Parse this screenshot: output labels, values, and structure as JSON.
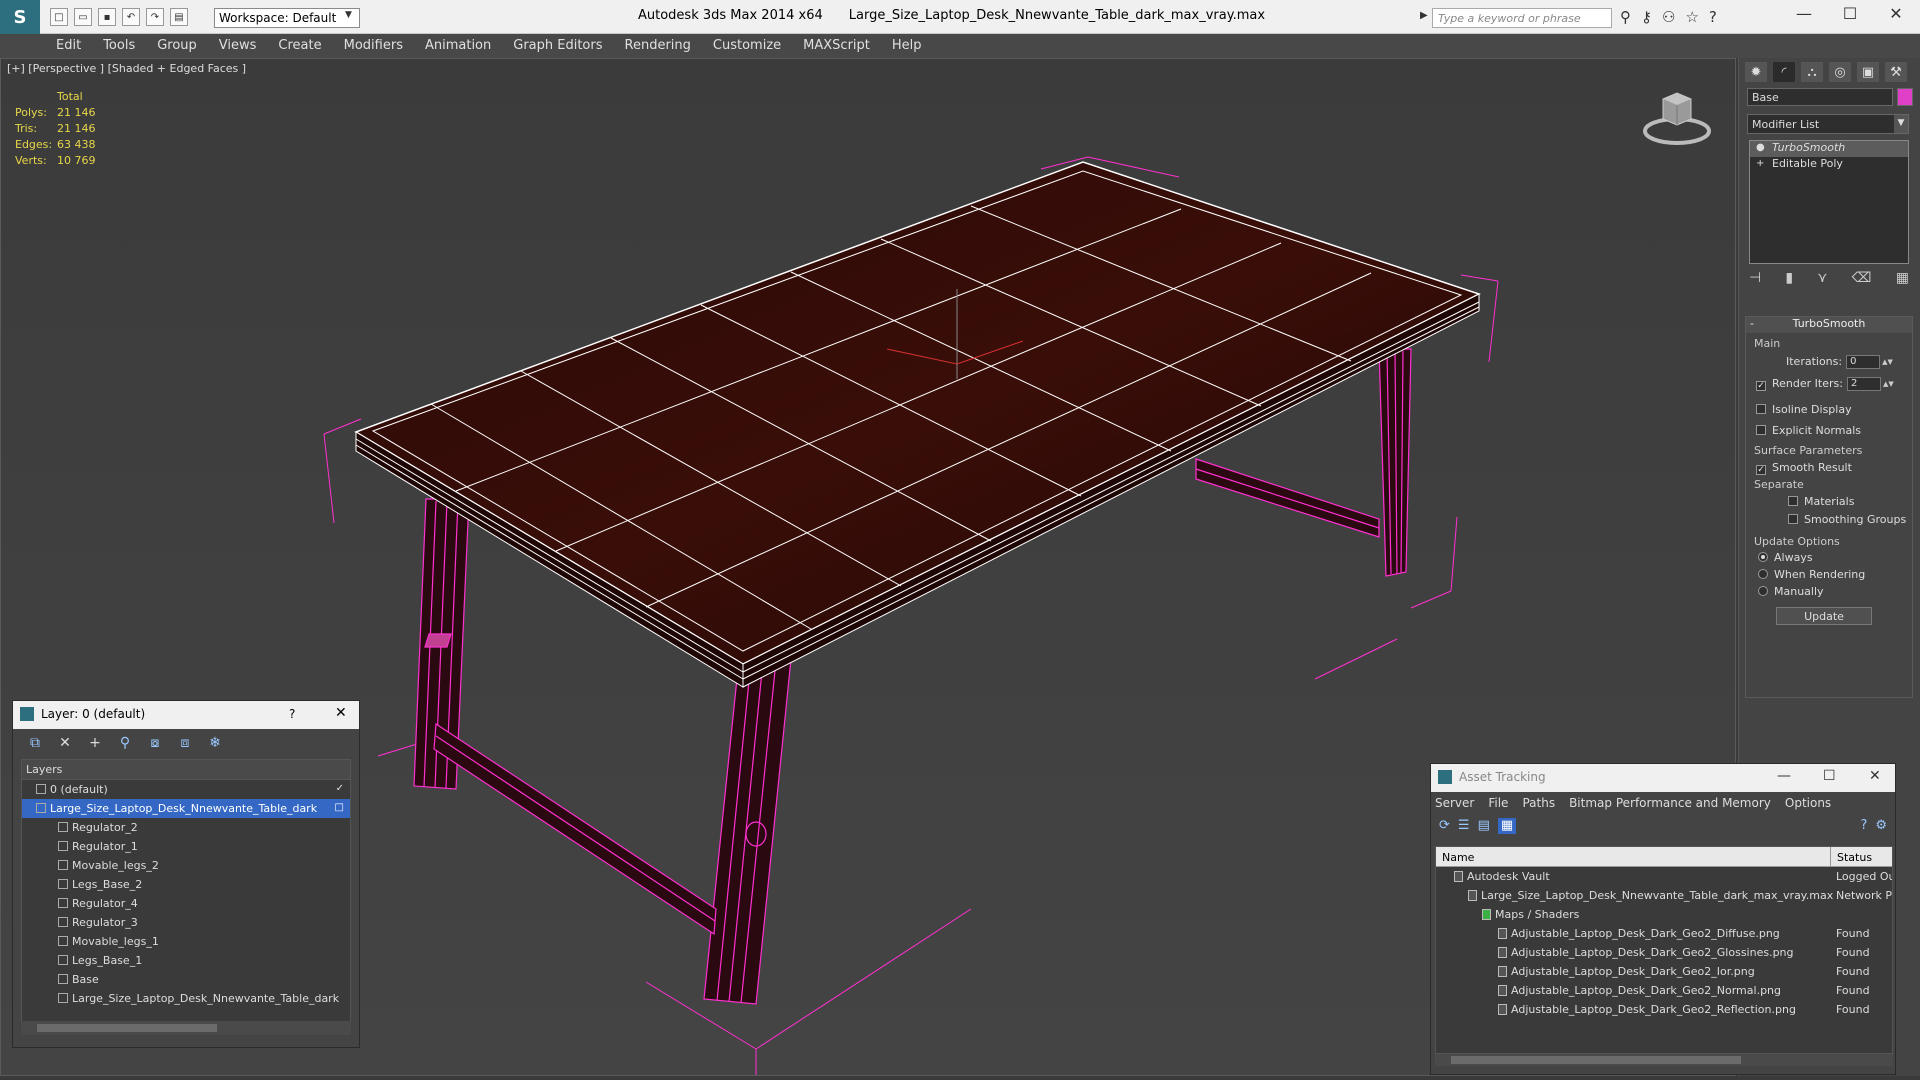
{
  "window": {
    "app_title": "Autodesk 3ds Max  2014 x64",
    "file_title": "Large_Size_Laptop_Desk_Nnewvante_Table_dark_max_vray.max",
    "workspace": "Workspace: Default",
    "search_placeholder": "Type a keyword or phrase"
  },
  "menu": [
    "Edit",
    "Tools",
    "Group",
    "Views",
    "Create",
    "Modifiers",
    "Animation",
    "Graph Editors",
    "Rendering",
    "Customize",
    "MAXScript",
    "Help"
  ],
  "viewport": {
    "label": "[+] [Perspective ] [Shaded + Edged Faces ]",
    "stats": {
      "header": "Total",
      "rows": [
        {
          "k": "Polys:",
          "v": "21 146"
        },
        {
          "k": "Tris:",
          "v": "21 146"
        },
        {
          "k": "Edges:",
          "v": "63 438"
        },
        {
          "k": "Verts:",
          "v": "10 769"
        }
      ]
    }
  },
  "command_panel": {
    "object_name": "Base",
    "object_color": "#e040c8",
    "modifier_list": "Modifier List",
    "stack": [
      "TurboSmooth",
      "Editable Poly"
    ],
    "turbosmooth": {
      "title": "TurboSmooth",
      "main": "Main",
      "iterations_label": "Iterations:",
      "iterations": "0",
      "render_iters_label": "Render Iters:",
      "render_iters": "2",
      "isoline": "Isoline Display",
      "explicit_normals": "Explicit Normals",
      "surface_params": "Surface Parameters",
      "smooth_result": "Smooth Result",
      "separate": "Separate",
      "materials": "Materials",
      "smoothing_groups": "Smoothing Groups",
      "update_options": "Update Options",
      "always": "Always",
      "when_rendering": "When Rendering",
      "manually": "Manually",
      "update_btn": "Update"
    }
  },
  "layer_panel": {
    "title": "Layer: 0 (default)",
    "help": "?",
    "header": "Layers",
    "rows": [
      {
        "name": "0 (default)",
        "indent": 0
      },
      {
        "name": "Large_Size_Laptop_Desk_Nnewvante_Table_dark",
        "indent": 0
      },
      {
        "name": "Regulator_2",
        "indent": 1
      },
      {
        "name": "Regulator_1",
        "indent": 1
      },
      {
        "name": "Movable_legs_2",
        "indent": 1
      },
      {
        "name": "Legs_Base_2",
        "indent": 1
      },
      {
        "name": "Regulator_4",
        "indent": 1
      },
      {
        "name": "Regulator_3",
        "indent": 1
      },
      {
        "name": "Movable_legs_1",
        "indent": 1
      },
      {
        "name": "Legs_Base_1",
        "indent": 1
      },
      {
        "name": "Base",
        "indent": 1
      },
      {
        "name": "Large_Size_Laptop_Desk_Nnewvante_Table_dark",
        "indent": 1
      }
    ]
  },
  "asset_panel": {
    "title": "Asset Tracking",
    "menu": [
      "Server",
      "File",
      "Paths",
      "Bitmap Performance and Memory",
      "Options"
    ],
    "col_name": "Name",
    "col_status": "Status",
    "rows": [
      {
        "name": "Autodesk Vault",
        "status": "Logged Ou",
        "indent": 1
      },
      {
        "name": "Large_Size_Laptop_Desk_Nnewvante_Table_dark_max_vray.max",
        "status": "Network P",
        "indent": 2
      },
      {
        "name": "Maps / Shaders",
        "status": "",
        "indent": 3
      },
      {
        "name": "Adjustable_Laptop_Desk_Dark_Geo2_Diffuse.png",
        "status": "Found",
        "indent": 4
      },
      {
        "name": "Adjustable_Laptop_Desk_Dark_Geo2_Glossines.png",
        "status": "Found",
        "indent": 4
      },
      {
        "name": "Adjustable_Laptop_Desk_Dark_Geo2_Ior.png",
        "status": "Found",
        "indent": 4
      },
      {
        "name": "Adjustable_Laptop_Desk_Dark_Geo2_Normal.png",
        "status": "Found",
        "indent": 4
      },
      {
        "name": "Adjustable_Laptop_Desk_Dark_Geo2_Reflection.png",
        "status": "Found",
        "indent": 4
      }
    ]
  },
  "colors": {
    "wire": "#ff30d0",
    "tabletop": "#2a0a06",
    "stats": "#e8d64a",
    "selection": "#3468c4"
  }
}
